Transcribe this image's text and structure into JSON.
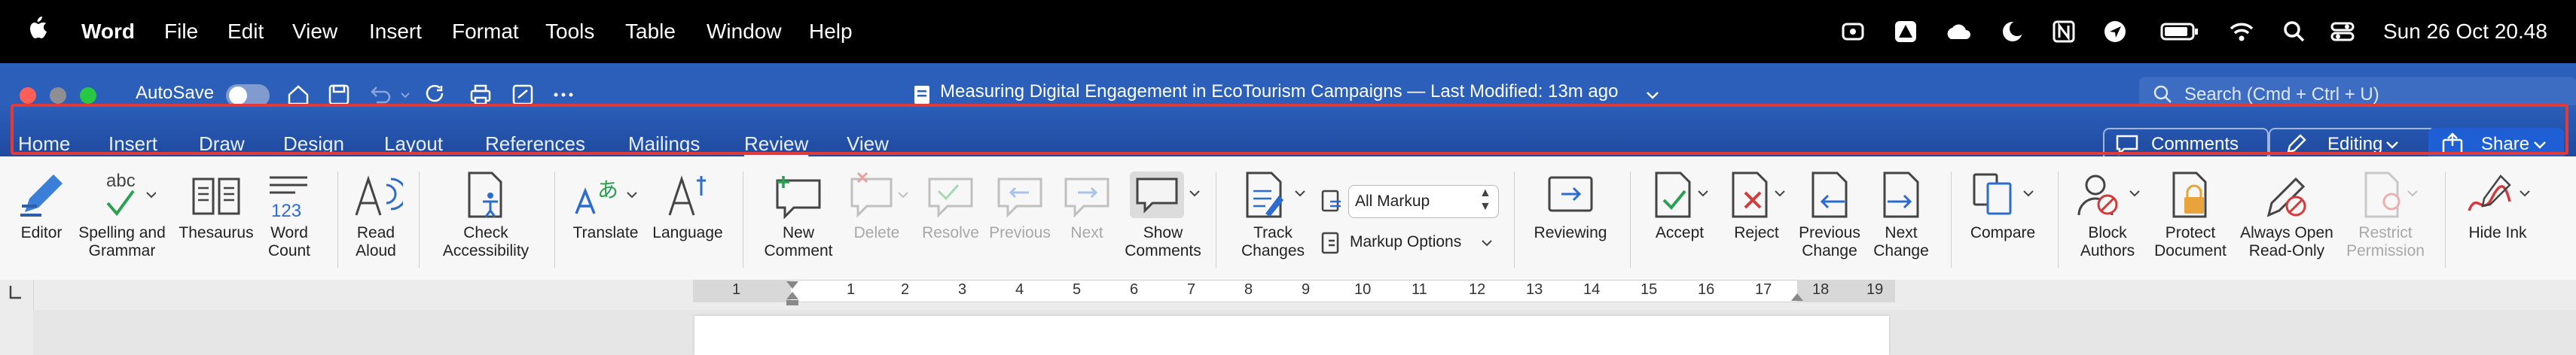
{
  "menubar": {
    "app": "Word",
    "items": [
      "File",
      "Edit",
      "View",
      "Insert",
      "Format",
      "Tools",
      "Table",
      "Window",
      "Help"
    ],
    "clock": "Sun 26 Oct  20.48"
  },
  "titlebar": {
    "autosave": "AutoSave",
    "doc_title": "Measuring Digital Engagement in EcoTourism Campaigns — Last Modified: 13m ago",
    "search_placeholder": "Search (Cmd + Ctrl + U)"
  },
  "tabs": [
    "Home",
    "Insert",
    "Draw",
    "Design",
    "Layout",
    "References",
    "Mailings",
    "Review",
    "View"
  ],
  "active_tab": "Review",
  "right_buttons": {
    "comments": "Comments",
    "editing": "Editing",
    "share": "Share"
  },
  "ribbon": {
    "editor": "Editor",
    "spelling": [
      "Spelling and",
      "Grammar"
    ],
    "spelling_glyph": "abc",
    "thesaurus": "Thesaurus",
    "word_count": [
      "Word",
      "Count"
    ],
    "word_count_glyph": "123",
    "read_aloud": [
      "Read",
      "Aloud"
    ],
    "check_access": [
      "Check",
      "Accessibility"
    ],
    "translate": "Translate",
    "translate_glyph": "あ",
    "language": "Language",
    "new_comment": [
      "New",
      "Comment"
    ],
    "delete": "Delete",
    "resolve": "Resolve",
    "previous": "Previous",
    "next": "Next",
    "show_comments": [
      "Show",
      "Comments"
    ],
    "track_changes": [
      "Track",
      "Changes"
    ],
    "all_markup": "All Markup",
    "markup_options": "Markup Options",
    "reviewing": "Reviewing",
    "accept": "Accept",
    "reject": "Reject",
    "previous_change": [
      "Previous",
      "Change"
    ],
    "next_change": [
      "Next",
      "Change"
    ],
    "compare": "Compare",
    "block_authors": [
      "Block",
      "Authors"
    ],
    "protect_document": [
      "Protect",
      "Document"
    ],
    "always_open": [
      "Always Open",
      "Read-Only"
    ],
    "restrict": [
      "Restrict",
      "Permission"
    ],
    "hide_ink": "Hide Ink"
  },
  "ruler_numbers": [
    "1",
    "1",
    "2",
    "3",
    "4",
    "5",
    "6",
    "7",
    "8",
    "9",
    "10",
    "11",
    "12",
    "13",
    "14",
    "15",
    "16",
    "17",
    "18",
    "19"
  ],
  "colors": {
    "title_blue": "#2b5fb9",
    "highlight_red": "#e03a3a",
    "share_blue": "#1e5fd6"
  }
}
